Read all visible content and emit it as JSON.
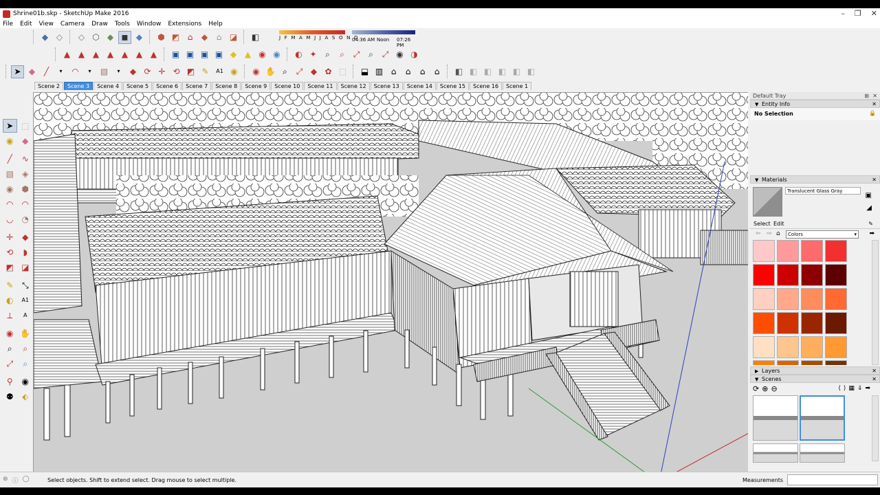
{
  "window": {
    "title": "Shrine01b.skp - SketchUp Make 2016",
    "controls": [
      "–",
      "❐",
      "✕"
    ]
  },
  "menu": [
    "File",
    "Edit",
    "View",
    "Camera",
    "Draw",
    "Tools",
    "Window",
    "Extensions",
    "Help"
  ],
  "shadow": {
    "months_label": "J F M A M J J A S O N D",
    "time_start": "04:36 AM",
    "time_mid": "Noon",
    "time_end": "07:26 PM"
  },
  "scene_tabs": [
    "Scene 2",
    "Scene 3",
    "Scene 4",
    "Scene 5",
    "Scene 6",
    "Scene 7",
    "Scene 8",
    "Scene 9",
    "Scene 10",
    "Scene 11",
    "Scene 12",
    "Scene 13",
    "Scene 14",
    "Scene 15",
    "Scene 16",
    "Scene 1"
  ],
  "active_scene": "Scene 3",
  "tray": {
    "title": "Default Tray",
    "entity_info": {
      "header": "Entity Info",
      "value": "No Selection"
    },
    "materials": {
      "header": "Materials",
      "material_name": "Translucent Glass Gray",
      "tab_select": "Select",
      "tab_edit": "Edit",
      "library": "Colors",
      "swatches": [
        "#ffc9c9",
        "#ff9a9a",
        "#ff6b6b",
        "#f23030",
        "#ff0000",
        "#cc0000",
        "#8e0000",
        "#5c0000",
        "#ffd0c0",
        "#ffa98a",
        "#ff8c5c",
        "#ff6a33",
        "#ff4d00",
        "#cc3300",
        "#992600",
        "#6b1a00",
        "#ffe0c2",
        "#ffc58f",
        "#ffae5c",
        "#ff9a33",
        "#ff8000",
        "#d96500",
        "#a64d00",
        "#733500"
      ]
    },
    "layers": {
      "header": "Layers"
    },
    "scenes": {
      "header": "Scenes"
    }
  },
  "status": {
    "text": "Select objects. Shift to extend select. Drag mouse to select multiple.",
    "measurements_label": "Measurements"
  },
  "icons": {
    "top_row1": [
      "box-icon",
      "box-outline-icon",
      "material-icon",
      "house-icon",
      "x-ray-icon",
      "shaded-icon",
      "iso-icon",
      "top-view-icon",
      "front-view-icon",
      "right-view-icon",
      "back-view-icon",
      "left-view-icon"
    ],
    "top_row2": [
      "sandbox-icon",
      "flip-icon",
      "move-icon",
      "rotate-icon",
      "scale-icon",
      "push-icon",
      "camera-icon",
      "walk-icon",
      "look-icon",
      "zoom-icon",
      "zoom-window-icon",
      "zoom-extents-icon",
      "pan-icon",
      "orbit-icon",
      "section-icon"
    ],
    "top_row3": [
      "select-icon",
      "eraser-icon",
      "line-icon",
      "arc-icon",
      "shapes-icon",
      "push-pull-icon",
      "move-icon",
      "rotate-icon",
      "scale-icon",
      "offset-icon",
      "tape-icon",
      "text-icon",
      "paint-icon",
      "orbit-icon",
      "pan-icon",
      "zoom-icon",
      "zoom-extents-icon",
      "warehouse-icon",
      "extension-icon",
      "share-icon",
      "home-icon",
      "component-icon",
      "layer-icon"
    ]
  }
}
